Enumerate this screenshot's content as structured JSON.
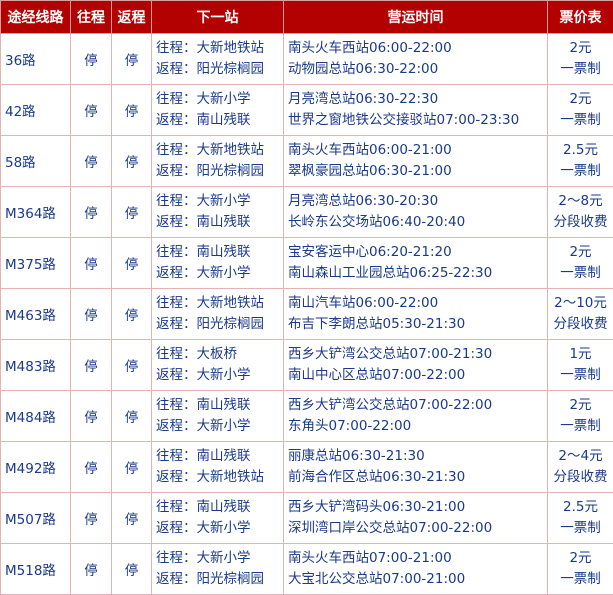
{
  "headers": {
    "route": "途经线路",
    "outbound": "往程",
    "return": "返程",
    "next_stop": "下一站",
    "hours": "营运时间",
    "fare": "票价表"
  },
  "rows": [
    {
      "route": "36路",
      "outbound": "停",
      "return": "停",
      "next_out": "往程：大新地铁站",
      "next_ret": "返程：阳光棕榈园",
      "hours1": "南头火车西站06:00-22:00",
      "hours2": "动物园总站06:30-22:00",
      "fare1": "2元",
      "fare2": "一票制"
    },
    {
      "route": "42路",
      "outbound": "停",
      "return": "停",
      "next_out": "往程：大新小学",
      "next_ret": "返程：南山残联",
      "hours1": "月亮湾总站06:30-22:30",
      "hours2": "世界之窗地铁公交接驳站07:00-23:30",
      "fare1": "2元",
      "fare2": "一票制"
    },
    {
      "route": "58路",
      "outbound": "停",
      "return": "停",
      "next_out": "往程：大新地铁站",
      "next_ret": "返程：阳光棕榈园",
      "hours1": "南头火车西站06:00-21:00",
      "hours2": "翠枫豪园总站06:30-21:00",
      "fare1": "2.5元",
      "fare2": "一票制"
    },
    {
      "route": "M364路",
      "outbound": "停",
      "return": "停",
      "next_out": "往程：大新小学",
      "next_ret": "返程：南山残联",
      "hours1": "月亮湾总站06:30-20:30",
      "hours2": "长岭东公交场站06:40-20:40",
      "fare1": "2～8元",
      "fare2": "分段收费"
    },
    {
      "route": "M375路",
      "outbound": "停",
      "return": "停",
      "next_out": "往程：南山残联",
      "next_ret": "返程：大新小学",
      "hours1": "宝安客运中心06:20-21:20",
      "hours2": "南山森山工业园总站06:25-22:30",
      "fare1": "2元",
      "fare2": "一票制"
    },
    {
      "route": "M463路",
      "outbound": "停",
      "return": "停",
      "next_out": "往程：大新地铁站",
      "next_ret": "返程：阳光棕榈园",
      "hours1": "南山汽车站06:00-22:00",
      "hours2": "布吉下李朗总站05:30-21:30",
      "fare1": "2～10元",
      "fare2": "分段收费"
    },
    {
      "route": "M483路",
      "outbound": "停",
      "return": "停",
      "next_out": "往程：大板桥",
      "next_ret": "返程：大新小学",
      "hours1": "西乡大铲湾公交总站07:00-21:30",
      "hours2": "南山中心区总站07:00-22:00",
      "fare1": "1元",
      "fare2": "一票制"
    },
    {
      "route": "M484路",
      "outbound": "停",
      "return": "停",
      "next_out": "往程：南山残联",
      "next_ret": "返程：大新小学",
      "hours1": "西乡大铲湾公交总站07:00-22:00",
      "hours2": "东角头07:00-22:00",
      "fare1": "2元",
      "fare2": "一票制"
    },
    {
      "route": "M492路",
      "outbound": "停",
      "return": "停",
      "next_out": "往程：南山残联",
      "next_ret": "返程：大新地铁站",
      "hours1": "丽康总站06:30-21:30",
      "hours2": "前海合作区总站06:30-21:30",
      "fare1": "2～4元",
      "fare2": "分段收费"
    },
    {
      "route": "M507路",
      "outbound": "停",
      "return": "停",
      "next_out": "往程：南山残联",
      "next_ret": "返程：大新小学",
      "hours1": "西乡大铲湾码头06:30-21:00",
      "hours2": "深圳湾口岸公交总站07:00-22:00",
      "fare1": "2.5元",
      "fare2": "一票制"
    },
    {
      "route": "M518路",
      "outbound": "停",
      "return": "停",
      "next_out": "往程：大新小学",
      "next_ret": "返程：阳光棕榈园",
      "hours1": "南头火车西站07:00-21:00",
      "hours2": "大宝北公交总站07:00-21:00",
      "fare1": "2元",
      "fare2": "一票制"
    }
  ],
  "colors": {
    "header_bg": "#b30000",
    "text": "#1a3a8a"
  }
}
